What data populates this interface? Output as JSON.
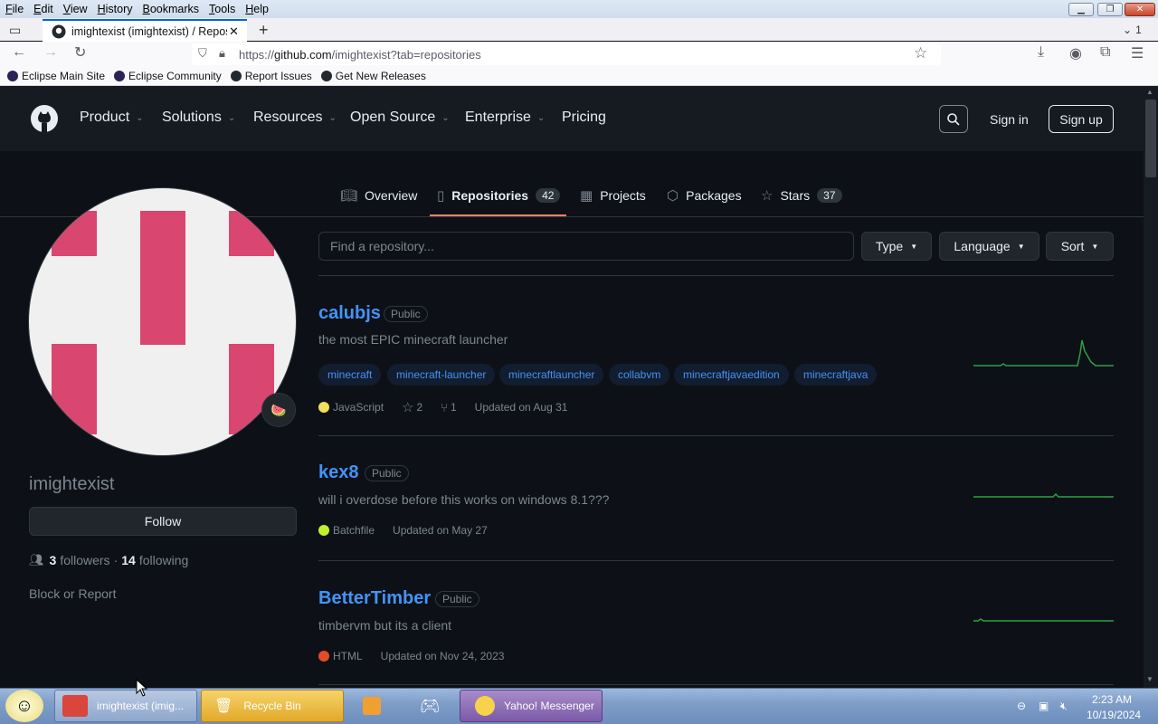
{
  "browser": {
    "menu": [
      "File",
      "Edit",
      "View",
      "History",
      "Bookmarks",
      "Tools",
      "Help"
    ],
    "tab_title": "imightexist (imightexist) / Repos",
    "tab_count": "1",
    "url_prefix": "https://",
    "url_host": "github.com",
    "url_path": "/imightexist?tab=repositories",
    "bookmarks": [
      "Eclipse Main Site",
      "Eclipse Community",
      "Report Issues",
      "Get New Releases"
    ]
  },
  "gh_header": {
    "nav": [
      "Product",
      "Solutions",
      "Resources",
      "Open Source",
      "Enterprise",
      "Pricing"
    ],
    "sign_in": "Sign in",
    "sign_up": "Sign up"
  },
  "profile_tabs": {
    "overview": "Overview",
    "repositories": "Repositories",
    "repositories_count": "42",
    "projects": "Projects",
    "packages": "Packages",
    "stars": "Stars",
    "stars_count": "37"
  },
  "profile": {
    "username": "imightexist",
    "follow": "Follow",
    "followers_count": "3",
    "followers_label": "followers",
    "separator": "·",
    "following_count": "14",
    "following_label": "following",
    "block_report": "Block or Report",
    "badge_emoji": "🍉"
  },
  "repo_filters": {
    "search_placeholder": "Find a repository...",
    "type": "Type",
    "language": "Language",
    "sort": "Sort"
  },
  "repos": [
    {
      "name": "calubjs",
      "visibility": "Public",
      "description": "the most EPIC minecraft launcher",
      "topics": [
        "minecraft",
        "minecraft-launcher",
        "minecraftlauncher",
        "collabvm",
        "minecraftjavaedition",
        "minecraftjava"
      ],
      "language": "JavaScript",
      "language_color": "#f1e05a",
      "stars": "2",
      "forks": "1",
      "updated": "Updated on Aug 31"
    },
    {
      "name": "kex8",
      "visibility": "Public",
      "description": "will i overdose before this works on windows 8.1???",
      "language": "Batchfile",
      "language_color": "#c1f12e",
      "updated": "Updated on May 27"
    },
    {
      "name": "BetterTimber",
      "visibility": "Public",
      "description": "timbervm but its a client",
      "language": "HTML",
      "language_color": "#e34c26",
      "updated": "Updated on Nov 24, 2023"
    }
  ],
  "taskbar": {
    "items": [
      "imightexist (imig...",
      "Recycle Bin",
      "Yahoo! Messenger"
    ],
    "time": "2:23 AM",
    "date": "10/19/2024"
  },
  "colors": {
    "accent_link": "#4493f8",
    "tab_underline": "#f78166",
    "avatar_pink": "#d9466f",
    "spark_green": "#2ea043"
  }
}
